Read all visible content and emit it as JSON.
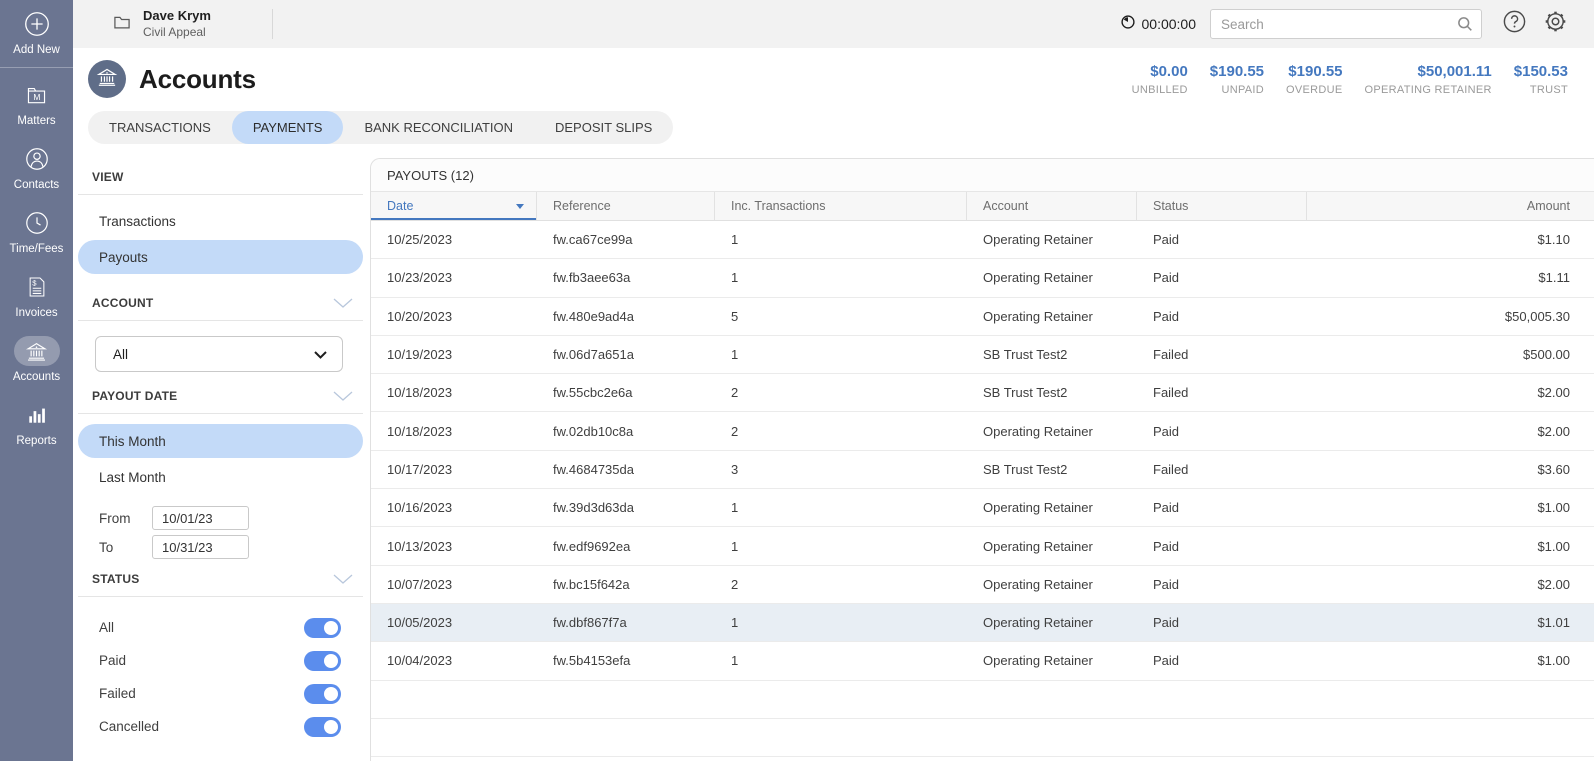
{
  "colors": {
    "accent_blue": "#4478bf",
    "selected_pill": "#c3daf8",
    "sidebar_bg": "#6b7591",
    "toggle_on": "#5b8ded",
    "row_highlight": "#e8eef4"
  },
  "sidebar": {
    "items": [
      {
        "key": "add-new",
        "label": "Add New",
        "icon": "plus-circle",
        "divider_after": true
      },
      {
        "key": "matters",
        "label": "Matters",
        "icon": "folder-m"
      },
      {
        "key": "contacts",
        "label": "Contacts",
        "icon": "person"
      },
      {
        "key": "time-fees",
        "label": "Time/Fees",
        "icon": "clock"
      },
      {
        "key": "invoices",
        "label": "Invoices",
        "icon": "invoice"
      },
      {
        "key": "accounts",
        "label": "Accounts",
        "icon": "bank",
        "active": true
      },
      {
        "key": "reports",
        "label": "Reports",
        "icon": "bar-chart"
      }
    ]
  },
  "topbar": {
    "matter_name": "Dave Krym",
    "matter_detail": "Civil Appeal",
    "timer": "00:00:00",
    "search": {
      "placeholder": "Search",
      "value": ""
    }
  },
  "page": {
    "title": "Accounts",
    "summary": [
      {
        "key": "unbilled",
        "value": "$0.00",
        "label": "UNBILLED"
      },
      {
        "key": "unpaid",
        "value": "$190.55",
        "label": "UNPAID"
      },
      {
        "key": "overdue",
        "value": "$190.55",
        "label": "OVERDUE"
      },
      {
        "key": "operating-retainer",
        "value": "$50,001.11",
        "label": "OPERATING RETAINER"
      },
      {
        "key": "trust",
        "value": "$150.53",
        "label": "TRUST"
      }
    ],
    "tabs": [
      {
        "key": "transactions",
        "label": "TRANSACTIONS"
      },
      {
        "key": "payments",
        "label": "PAYMENTS",
        "active": true
      },
      {
        "key": "bank-reconciliation",
        "label": "BANK RECONCILIATION"
      },
      {
        "key": "deposit-slips",
        "label": "DEPOSIT SLIPS"
      }
    ]
  },
  "filters": {
    "view": {
      "title": "VIEW",
      "options": [
        {
          "key": "transactions",
          "label": "Transactions"
        },
        {
          "key": "payouts",
          "label": "Payouts",
          "selected": true
        }
      ]
    },
    "account": {
      "title": "ACCOUNT",
      "value": "All"
    },
    "payout_date": {
      "title": "PAYOUT DATE",
      "options": [
        {
          "key": "this-month",
          "label": "This Month",
          "selected": true
        },
        {
          "key": "last-month",
          "label": "Last Month"
        }
      ],
      "from_label": "From",
      "from_value": "10/01/23",
      "to_label": "To",
      "to_value": "10/31/23"
    },
    "status": {
      "title": "STATUS",
      "toggles": [
        {
          "key": "all",
          "label": "All",
          "on": true
        },
        {
          "key": "paid",
          "label": "Paid",
          "on": true
        },
        {
          "key": "failed",
          "label": "Failed",
          "on": true
        },
        {
          "key": "cancelled",
          "label": "Cancelled",
          "on": true
        }
      ]
    }
  },
  "table": {
    "title": "PAYOUTS (12)",
    "columns": [
      {
        "key": "date",
        "label": "Date",
        "sorted": true,
        "sort_dir": "desc"
      },
      {
        "key": "reference",
        "label": "Reference"
      },
      {
        "key": "inc-transactions",
        "label": "Inc. Transactions"
      },
      {
        "key": "account",
        "label": "Account"
      },
      {
        "key": "status",
        "label": "Status"
      },
      {
        "key": "amount",
        "label": "Amount"
      }
    ],
    "rows": [
      {
        "date": "10/25/2023",
        "reference": "fw.ca67ce99a",
        "inc_transactions": "1",
        "account": "Operating Retainer",
        "status": "Paid",
        "amount": "$1.10"
      },
      {
        "date": "10/23/2023",
        "reference": "fw.fb3aee63a",
        "inc_transactions": "1",
        "account": "Operating Retainer",
        "status": "Paid",
        "amount": "$1.11"
      },
      {
        "date": "10/20/2023",
        "reference": "fw.480e9ad4a",
        "inc_transactions": "5",
        "account": "Operating Retainer",
        "status": "Paid",
        "amount": "$50,005.30"
      },
      {
        "date": "10/19/2023",
        "reference": "fw.06d7a651a",
        "inc_transactions": "1",
        "account": "SB Trust Test2",
        "status": "Failed",
        "amount": "$500.00"
      },
      {
        "date": "10/18/2023",
        "reference": "fw.55cbc2e6a",
        "inc_transactions": "2",
        "account": "SB Trust Test2",
        "status": "Failed",
        "amount": "$2.00"
      },
      {
        "date": "10/18/2023",
        "reference": "fw.02db10c8a",
        "inc_transactions": "2",
        "account": "Operating Retainer",
        "status": "Paid",
        "amount": "$2.00"
      },
      {
        "date": "10/17/2023",
        "reference": "fw.4684735da",
        "inc_transactions": "3",
        "account": "SB Trust Test2",
        "status": "Failed",
        "amount": "$3.60"
      },
      {
        "date": "10/16/2023",
        "reference": "fw.39d3d63da",
        "inc_transactions": "1",
        "account": "Operating Retainer",
        "status": "Paid",
        "amount": "$1.00"
      },
      {
        "date": "10/13/2023",
        "reference": "fw.edf9692ea",
        "inc_transactions": "1",
        "account": "Operating Retainer",
        "status": "Paid",
        "amount": "$1.00"
      },
      {
        "date": "10/07/2023",
        "reference": "fw.bc15f642a",
        "inc_transactions": "2",
        "account": "Operating Retainer",
        "status": "Paid",
        "amount": "$2.00"
      },
      {
        "date": "10/05/2023",
        "reference": "fw.dbf867f7a",
        "inc_transactions": "1",
        "account": "Operating Retainer",
        "status": "Paid",
        "amount": "$1.01",
        "highlighted": true
      },
      {
        "date": "10/04/2023",
        "reference": "fw.5b4153efa",
        "inc_transactions": "1",
        "account": "Operating Retainer",
        "status": "Paid",
        "amount": "$1.00"
      }
    ]
  }
}
